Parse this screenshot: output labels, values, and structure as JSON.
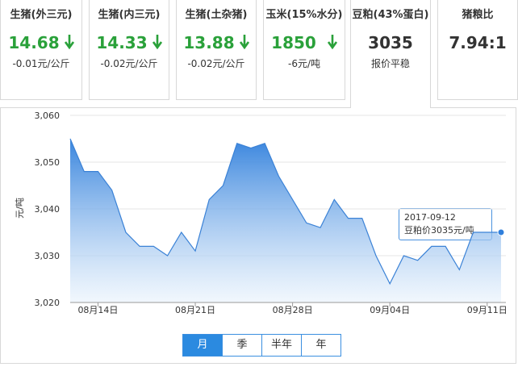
{
  "cards": [
    {
      "title": "生猪(外三元)",
      "price": "14.68",
      "change": "-0.01元/公斤",
      "trend": "down"
    },
    {
      "title": "生猪(内三元)",
      "price": "14.33",
      "change": "-0.02元/公斤",
      "trend": "down"
    },
    {
      "title": "生猪(土杂猪)",
      "price": "13.88",
      "change": "-0.02元/公斤",
      "trend": "down"
    },
    {
      "title": "玉米(15%水分)",
      "price": "1850",
      "change": "-6元/吨",
      "trend": "down"
    },
    {
      "title": "豆粕(43%蛋白)",
      "price": "3035",
      "change": "报价平稳",
      "trend": "flat"
    },
    {
      "title": "猪粮比",
      "price": "7.94:1",
      "change": "",
      "trend": "none"
    }
  ],
  "colors": {
    "down": "#2aa13a",
    "accent": "#2b8ae0",
    "line": "#3b82d6"
  },
  "chart_data": {
    "type": "area",
    "ylabel": "元/吨",
    "ylim": [
      3020,
      3060
    ],
    "yticks": [
      "3,060",
      "3,050",
      "3,040",
      "3,030",
      "3,020"
    ],
    "ytick_values": [
      3060,
      3050,
      3040,
      3030,
      3020
    ],
    "xticks": [
      "08月14日",
      "08月21日",
      "08月28日",
      "09月04日",
      "09月11日"
    ],
    "x": [
      "08-12",
      "08-13",
      "08-14",
      "08-15",
      "08-16",
      "08-17",
      "08-18",
      "08-19",
      "08-20",
      "08-21",
      "08-22",
      "08-23",
      "08-24",
      "08-25",
      "08-26",
      "08-27",
      "08-28",
      "08-29",
      "08-30",
      "08-31",
      "09-01",
      "09-02",
      "09-03",
      "09-04",
      "09-05",
      "09-06",
      "09-07",
      "09-08",
      "09-09",
      "09-10",
      "09-11",
      "09-12"
    ],
    "values": [
      3055,
      3048,
      3048,
      3044,
      3035,
      3032,
      3032,
      3030,
      3035,
      3031,
      3042,
      3045,
      3054,
      3053,
      3054,
      3047,
      3042,
      3037,
      3036,
      3042,
      3038,
      3038,
      3030,
      3024,
      3030,
      3029,
      3032,
      3032,
      3027,
      3035,
      3035,
      3035
    ],
    "grid": true
  },
  "tooltip": {
    "date": "2017-09-12",
    "text": "豆粕价3035元/吨"
  },
  "range_buttons": [
    {
      "label": "月",
      "active": true
    },
    {
      "label": "季",
      "active": false
    },
    {
      "label": "半年",
      "active": false
    },
    {
      "label": "年",
      "active": false
    }
  ]
}
